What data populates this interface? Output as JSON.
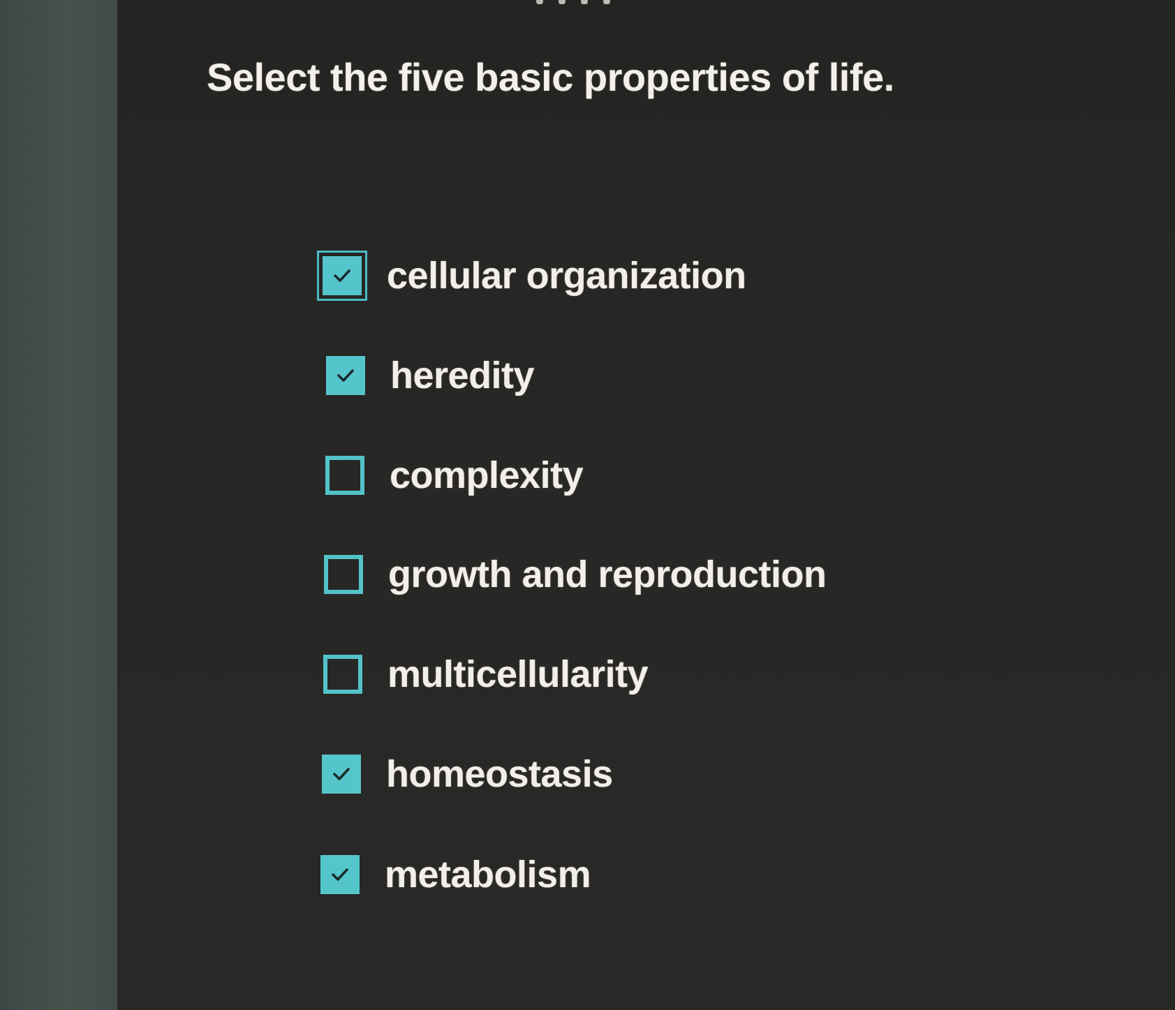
{
  "question": {
    "text": "Select the five basic properties of life."
  },
  "options": [
    {
      "label": "cellular organization",
      "checked": true,
      "focused": true
    },
    {
      "label": "heredity",
      "checked": true,
      "focused": false
    },
    {
      "label": "complexity",
      "checked": false,
      "focused": false
    },
    {
      "label": "growth and reproduction",
      "checked": false,
      "focused": false
    },
    {
      "label": "multicellularity",
      "checked": false,
      "focused": false
    },
    {
      "label": "homeostasis",
      "checked": true,
      "focused": false
    },
    {
      "label": "metabolism",
      "checked": true,
      "focused": false
    }
  ],
  "colors": {
    "accent": "#55c5cc",
    "background": "#262624",
    "text": "#f2eee8"
  },
  "icons": {
    "checked": "checkmark-icon"
  }
}
